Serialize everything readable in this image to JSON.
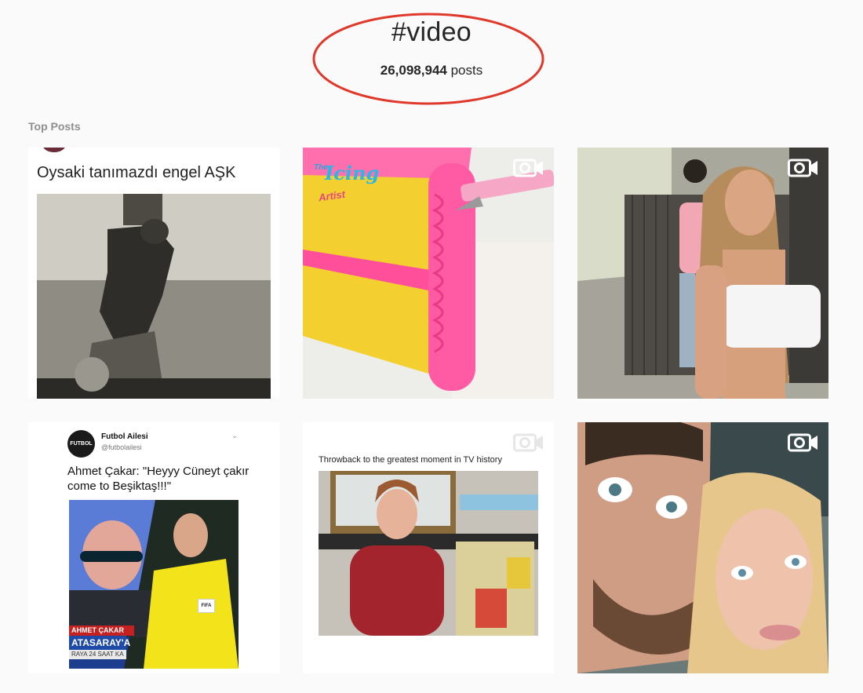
{
  "header": {
    "hashtag": "#video",
    "post_count": "26,098,944",
    "post_count_suffix": " posts"
  },
  "section": {
    "label": "Top Posts"
  },
  "colors": {
    "annotation_ellipse": "#e0392b",
    "background": "#fafafa",
    "section_label": "#8e8e8e"
  },
  "posts": [
    {
      "type": "image",
      "title": "Oysaki tanımazdı engel AŞK"
    },
    {
      "type": "video",
      "icon": "video-camera-icon",
      "logo_text": {
        "the": "The",
        "main": "Icing",
        "sub": "Artist"
      }
    },
    {
      "type": "video",
      "icon": "video-camera-icon"
    },
    {
      "type": "image",
      "tweet": {
        "avatar_text": "FUTBOL",
        "name": "Futbol Ailesi",
        "handle": "@futbolailesi",
        "text": "Ahmet Çakar: \"Heyyy Cüneyt çakır come to Beşiktaş!!!\""
      },
      "tv": {
        "banner_name": "AHMET ÇAKAR",
        "banner_team": "ATASARAY'A",
        "banner_ticker": "RAYA 24 SAAT KA",
        "badge": "FIFA"
      }
    },
    {
      "type": "video",
      "icon": "video-camera-icon",
      "caption": "Throwback to the greatest moment in TV history"
    },
    {
      "type": "video",
      "icon": "video-camera-icon"
    }
  ]
}
